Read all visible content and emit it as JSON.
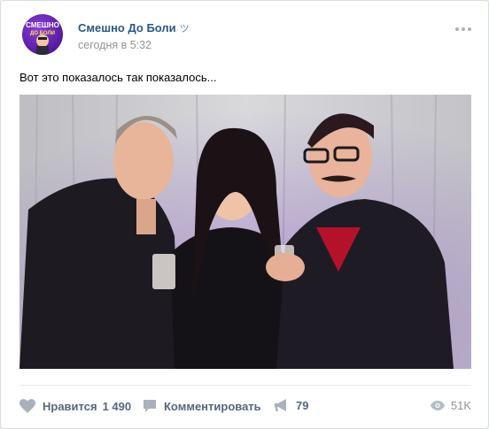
{
  "post": {
    "author": "Смешно До Боли",
    "verified_mark": "ツ",
    "avatar_text_line1": "СМЕШНО",
    "avatar_text_line2": "ДО БОЛИ",
    "time": "сегодня в 5:32",
    "text": "Вот это показалось так показалось..."
  },
  "actions": {
    "like_label": "Нравится",
    "like_count": "1 490",
    "comment_label": "Комментировать",
    "share_count": "79",
    "views_count": "51K"
  },
  "icons": {
    "more": "more-icon",
    "like": "heart-icon",
    "comment": "comment-icon",
    "share": "megaphone-icon",
    "views": "eye-icon"
  },
  "colors": {
    "author_link": "#2a5885",
    "action_text": "#55677d",
    "muted": "#939393",
    "icon": "#a9b1bd"
  }
}
